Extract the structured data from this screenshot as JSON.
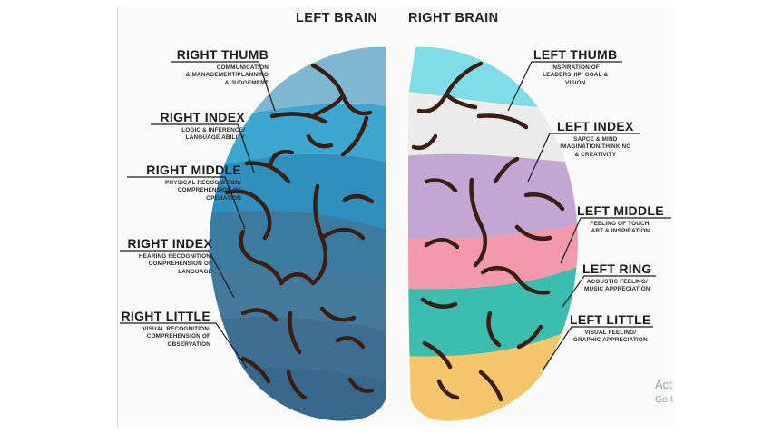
{
  "headers": {
    "left": "LEFT BRAIN",
    "right": "RIGHT BRAIN"
  },
  "left_labels": [
    {
      "title": "RIGHT THUMB",
      "desc": [
        "COMMUNICATION",
        "& MANAGEMENT/PLANNING",
        "& JUDGEMENT"
      ]
    },
    {
      "title": "RIGHT INDEX",
      "desc": [
        "LOGIC & INFERENCE/",
        "LANGUAGE ABILITY"
      ]
    },
    {
      "title": "RIGHT MIDDLE",
      "desc": [
        "PHYSICAL RECOGNITION/",
        "COMPREHENSION OF",
        "OPERATION"
      ]
    },
    {
      "title": "RIGHT INDEX",
      "desc": [
        "HEARING RECOGNITION/",
        "COMPREHENSION OF",
        "LANGUAGE"
      ]
    },
    {
      "title": "RIGHT LITTLE",
      "desc": [
        "VISUAL RECOGNITION/",
        "COMPREHENSION OF",
        "OBSERVATION"
      ]
    }
  ],
  "right_labels": [
    {
      "title": "LEFT THUMB",
      "desc": [
        "INSPIRATION OF",
        "LEADERSHIP/ GOAL &",
        "VISION"
      ]
    },
    {
      "title": "LEFT INDEX",
      "desc": [
        "SAPCE & MIND",
        "IMAGINATION/THINKING",
        "& CREATIVITY"
      ]
    },
    {
      "title": "LEFT MIDDLE",
      "desc": [
        "FEELING OF TOUCH/",
        "ART & INSPIRATION"
      ]
    },
    {
      "title": "LEFT RING",
      "desc": [
        "ACOUSTIC FEELING/",
        "MUSIC APPRECIATION"
      ]
    },
    {
      "title": "LEFT LITTLE",
      "desc": [
        "VISUAL FEELING/",
        "GRAPHIC APPRECIATION"
      ]
    }
  ],
  "watermark": {
    "line1": "Act",
    "line2": "Go t"
  },
  "colors": {
    "left_bands": [
      "#7fb7d2",
      "#3ea7cf",
      "#2f8fbf",
      "#3c7ba0",
      "#44799c",
      "#3e6f92",
      "#38688c"
    ],
    "right_bands": [
      "#7fdde8",
      "#ececec",
      "#c3a6d3",
      "#f29aab",
      "#3bbdb0",
      "#f4c56a"
    ],
    "veins": "#3a1e14"
  }
}
